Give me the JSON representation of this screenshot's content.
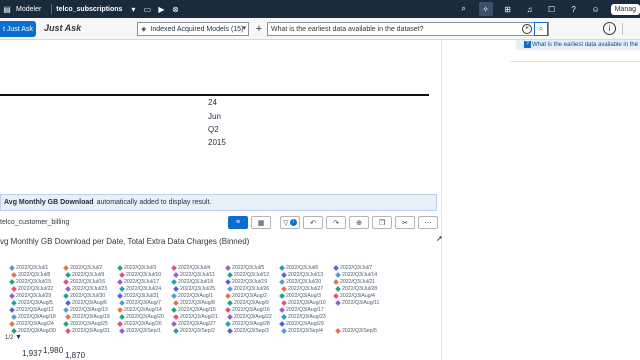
{
  "shell": {
    "app_name": "Modeler",
    "story_name": "telco_subscriptions",
    "manage_label": "Manag"
  },
  "toolbar": {
    "just_ask_button": "t Just Ask",
    "title": "Just Ask",
    "model_select": "Indexed Acquired Models (15)",
    "query": "What is the earliest data available in the dataset?"
  },
  "side_panel": {
    "question": "What is the earliest data available in the"
  },
  "result": {
    "values": [
      "24",
      "Jun",
      "Q2",
      "2015"
    ]
  },
  "message": {
    "bold": "Avg Monthly GB Download",
    "rest": "automatically added to display result."
  },
  "chart_panel": {
    "dataset": "telco_customer_billing",
    "title": "vg Monthly GB Download per Date, Total Extra Data Charges (Binned)",
    "pager": "1/2",
    "data_labels": [
      "1,937",
      "1,980",
      "1,870"
    ]
  },
  "legend": {
    "rows": [
      [
        "2022/Q3/Jul/1",
        "2022/Q3/Jul/2",
        "2022/Q3/Jul/3",
        "2022/Q3/Jul/4",
        "2022/Q3/Jul/5",
        "2022/Q3/Jul/6",
        "2022/Q3/Jul/7"
      ],
      [
        "2022/Q3/Jul/8",
        "2022/Q3/Jul/9",
        "2022/Q3/Jul/10",
        "2022/Q3/Jul/11",
        "2022/Q3/Jul/12",
        "2022/Q3/Jul/13",
        "2022/Q3/Jul/14"
      ],
      [
        "2022/Q3/Jul/15",
        "2022/Q3/Jul/16",
        "2022/Q3/Jul/17",
        "2022/Q3/Jul/18",
        "2022/Q3/Jul/19",
        "2022/Q3/Jul/20",
        "2022/Q3/Jul/21"
      ],
      [
        "2022/Q3/Jul/22",
        "2022/Q3/Jul/23",
        "2022/Q3/Jul/24",
        "2022/Q3/Jul/25",
        "2022/Q3/Jul/26",
        "2022/Q3/Jul/27",
        "2022/Q3/Jul/28"
      ],
      [
        "2022/Q3/Jul/29",
        "2022/Q3/Jul/30",
        "2022/Q3/Jul/31",
        "2022/Q3/Aug/1",
        "2022/Q3/Aug/2",
        "2022/Q3/Aug/3",
        "2022/Q3/Aug/4"
      ],
      [
        "2022/Q3/Aug/5",
        "2022/Q3/Aug/6",
        "2022/Q3/Aug/7",
        "2022/Q3/Aug/8",
        "2022/Q3/Aug/9",
        "2022/Q3/Aug/10",
        "2022/Q3/Aug/11"
      ],
      [
        "2022/Q3/Aug/12",
        "2022/Q3/Aug/13",
        "2022/Q3/Aug/14",
        "2022/Q3/Aug/15",
        "2022/Q3/Aug/16",
        "2022/Q3/Aug/17",
        ""
      ],
      [
        "2022/Q3/Aug/18",
        "2022/Q3/Aug/19",
        "2022/Q3/Aug/20",
        "2022/Q3/Aug/21",
        "2022/Q3/Aug/22",
        "2022/Q3/Aug/23",
        ""
      ],
      [
        "2022/Q3/Aug/24",
        "2022/Q3/Aug/25",
        "2022/Q3/Aug/26",
        "2022/Q3/Aug/27",
        "2022/Q3/Aug/28",
        "2022/Q3/Aug/29",
        ""
      ],
      [
        "2022/Q3/Aug/30",
        "2022/Q3/Aug/31",
        "2022/Q3/Sep/1",
        "2022/Q3/Sep/2",
        "2022/Q3/Sep/3",
        "2022/Q3/Sep/4",
        "2022/Q3/Sep/5"
      ]
    ],
    "colors": [
      "#5899da",
      "#e8743b",
      "#19a979",
      "#ed4a7b",
      "#945ecf",
      "#13a4b4",
      "#525df4"
    ]
  },
  "icons": {
    "shell_left": [
      "grid-icon",
      "chevron-down-icon",
      "monitor-icon",
      "play-icon",
      "close-circle-icon"
    ],
    "shell_right": [
      "search-icon",
      "lightbulb-icon",
      "grid-icon",
      "bell-icon",
      "chat-icon",
      "help-icon",
      "user-icon"
    ]
  }
}
